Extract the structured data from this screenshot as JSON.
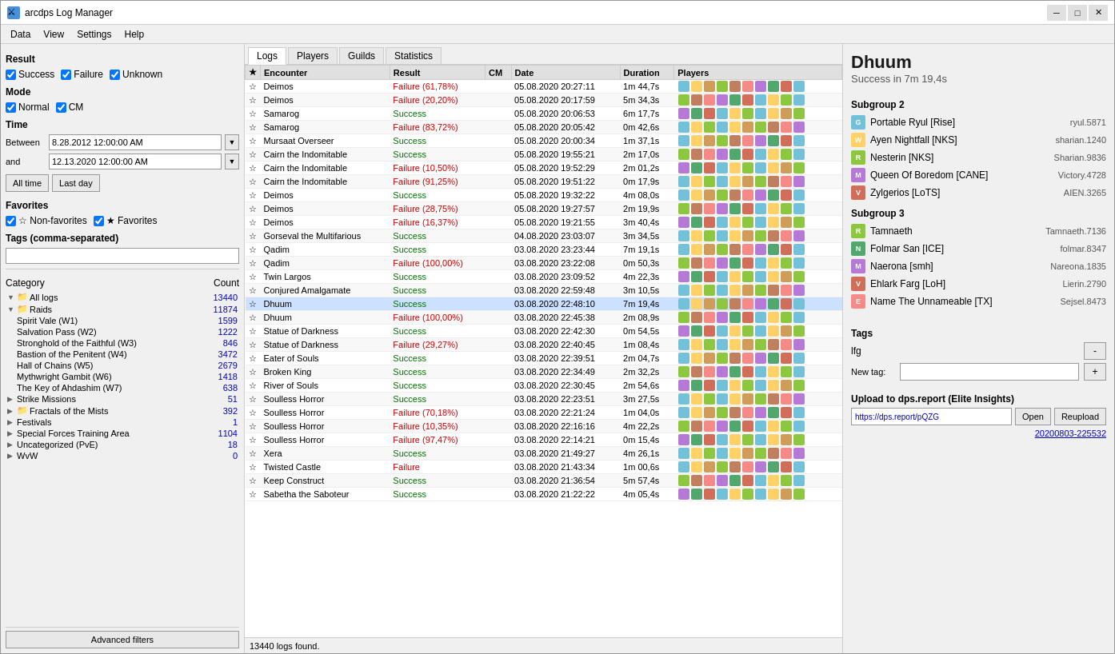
{
  "window": {
    "title": "arcdps Log Manager",
    "titlebar_icon": "⚔"
  },
  "menubar": {
    "items": [
      "Data",
      "View",
      "Settings",
      "Help"
    ]
  },
  "left_panel": {
    "result_label": "Result",
    "result_checkboxes": [
      {
        "label": "Success",
        "checked": true
      },
      {
        "label": "Failure",
        "checked": true
      },
      {
        "label": "Unknown",
        "checked": true
      }
    ],
    "mode_label": "Mode",
    "mode_checkboxes": [
      {
        "label": "Normal",
        "checked": true
      },
      {
        "label": "CM",
        "checked": true
      }
    ],
    "time_label": "Time",
    "between_label": "Between",
    "between_value": "8.28.2012 12:00:00 AM",
    "and_label": "and",
    "and_value": "12.13.2020 12:00:00 AM",
    "btn_all_time": "All time",
    "btn_last_day": "Last day",
    "favorites_label": "Favorites",
    "favorites_checkboxes": [
      {
        "label": "☆ Non-favorites",
        "checked": true
      },
      {
        "label": "★ Favorites",
        "checked": true
      }
    ],
    "tags_label": "Tags (comma-separated)",
    "tags_value": "",
    "category_label": "Category",
    "count_label": "Count",
    "categories": [
      {
        "level": 0,
        "arrow": "▼",
        "icon": "folder",
        "label": "All logs",
        "count": "13440",
        "selected": false
      },
      {
        "level": 1,
        "arrow": "▼",
        "icon": "folder-red",
        "label": "Raids",
        "count": "11874",
        "selected": false
      },
      {
        "level": 2,
        "arrow": "",
        "icon": "",
        "label": "Spirit Vale (W1)",
        "count": "1599",
        "selected": false
      },
      {
        "level": 2,
        "arrow": "",
        "icon": "",
        "label": "Salvation Pass (W2)",
        "count": "1222",
        "selected": false
      },
      {
        "level": 2,
        "arrow": "",
        "icon": "",
        "label": "Stronghold of the Faithful (W3)",
        "count": "846",
        "selected": false
      },
      {
        "level": 2,
        "arrow": "",
        "icon": "",
        "label": "Bastion of the Penitent (W4)",
        "count": "3472",
        "selected": false
      },
      {
        "level": 2,
        "arrow": "",
        "icon": "",
        "label": "Hall of Chains (W5)",
        "count": "2679",
        "selected": false
      },
      {
        "level": 2,
        "arrow": "",
        "icon": "",
        "label": "Mythwright Gambit (W6)",
        "count": "1418",
        "selected": false
      },
      {
        "level": 2,
        "arrow": "",
        "icon": "",
        "label": "The Key of Ahdashim (W7)",
        "count": "638",
        "selected": false
      },
      {
        "level": 1,
        "arrow": "▶",
        "icon": "",
        "label": "Strike Missions",
        "count": "51",
        "selected": false
      },
      {
        "level": 1,
        "arrow": "▶",
        "icon": "folder-red",
        "label": "Fractals of the Mists",
        "count": "392",
        "selected": false
      },
      {
        "level": 1,
        "arrow": "▶",
        "icon": "",
        "label": "Festivals",
        "count": "1",
        "selected": false,
        "count_color": "blue"
      },
      {
        "level": 1,
        "arrow": "▶",
        "icon": "",
        "label": "Special Forces Training Area",
        "count": "1104",
        "selected": false,
        "count_color": "blue"
      },
      {
        "level": 1,
        "arrow": "▶",
        "icon": "",
        "label": "Uncategorized (PvE)",
        "count": "18",
        "selected": false,
        "count_color": "blue"
      },
      {
        "level": 1,
        "arrow": "▶",
        "icon": "",
        "label": "WvW",
        "count": "0",
        "selected": false
      }
    ],
    "advanced_filters_label": "Advanced filters",
    "status_bar": "13440 logs found."
  },
  "tabs": {
    "items": [
      "Logs",
      "Players",
      "Guilds",
      "Statistics"
    ],
    "active": "Logs"
  },
  "log_table": {
    "columns": [
      "★",
      "Encounter",
      "Result",
      "CM",
      "Date",
      "Duration",
      "Players"
    ],
    "rows": [
      {
        "star": "☆",
        "encounter": "Deimos",
        "result": "Failure (61,78%)",
        "result_type": "failure",
        "cm": "",
        "date": "05.08.2020 20:27:11",
        "duration": "1m 44,7s",
        "selected": false
      },
      {
        "star": "☆",
        "encounter": "Deimos",
        "result": "Failure (20,20%)",
        "result_type": "failure",
        "cm": "",
        "date": "05.08.2020 20:17:59",
        "duration": "5m 34,3s",
        "selected": false
      },
      {
        "star": "☆",
        "encounter": "Samarog",
        "result": "Success",
        "result_type": "success",
        "cm": "",
        "date": "05.08.2020 20:06:53",
        "duration": "6m 17,7s",
        "selected": false
      },
      {
        "star": "☆",
        "encounter": "Samarog",
        "result": "Failure (83,72%)",
        "result_type": "failure",
        "cm": "",
        "date": "05.08.2020 20:05:42",
        "duration": "0m 42,6s",
        "selected": false
      },
      {
        "star": "☆",
        "encounter": "Mursaat Overseer",
        "result": "Success",
        "result_type": "success",
        "cm": "",
        "date": "05.08.2020 20:00:34",
        "duration": "1m 37,1s",
        "selected": false
      },
      {
        "star": "☆",
        "encounter": "Cairn the Indomitable",
        "result": "Success",
        "result_type": "success",
        "cm": "",
        "date": "05.08.2020 19:55:21",
        "duration": "2m 17,0s",
        "selected": false
      },
      {
        "star": "☆",
        "encounter": "Cairn the Indomitable",
        "result": "Failure (10,50%)",
        "result_type": "failure",
        "cm": "",
        "date": "05.08.2020 19:52:29",
        "duration": "2m 01,2s",
        "selected": false
      },
      {
        "star": "☆",
        "encounter": "Cairn the Indomitable",
        "result": "Failure (91,25%)",
        "result_type": "failure",
        "cm": "",
        "date": "05.08.2020 19:51:22",
        "duration": "0m 17,9s",
        "selected": false
      },
      {
        "star": "☆",
        "encounter": "Deimos",
        "result": "Success",
        "result_type": "success",
        "cm": "",
        "date": "05.08.2020 19:32:22",
        "duration": "4m 08,0s",
        "selected": false
      },
      {
        "star": "☆",
        "encounter": "Deimos",
        "result": "Failure (28,75%)",
        "result_type": "failure",
        "cm": "",
        "date": "05.08.2020 19:27:57",
        "duration": "2m 19,9s",
        "selected": false
      },
      {
        "star": "☆",
        "encounter": "Deimos",
        "result": "Failure (16,37%)",
        "result_type": "failure",
        "cm": "",
        "date": "05.08.2020 19:21:55",
        "duration": "3m 40,4s",
        "selected": false
      },
      {
        "star": "☆",
        "encounter": "Gorseval the Multifarious",
        "result": "Success",
        "result_type": "success",
        "cm": "",
        "date": "04.08.2020 23:03:07",
        "duration": "3m 34,5s",
        "selected": false
      },
      {
        "star": "☆",
        "encounter": "Qadim",
        "result": "Success",
        "result_type": "success",
        "cm": "",
        "date": "03.08.2020 23:23:44",
        "duration": "7m 19,1s",
        "selected": false
      },
      {
        "star": "☆",
        "encounter": "Qadim",
        "result": "Failure (100,00%)",
        "result_type": "failure",
        "cm": "",
        "date": "03.08.2020 23:22:08",
        "duration": "0m 50,3s",
        "selected": false
      },
      {
        "star": "☆",
        "encounter": "Twin Largos",
        "result": "Success",
        "result_type": "success",
        "cm": "",
        "date": "03.08.2020 23:09:52",
        "duration": "4m 22,3s",
        "selected": false
      },
      {
        "star": "☆",
        "encounter": "Conjured Amalgamate",
        "result": "Success",
        "result_type": "success",
        "cm": "",
        "date": "03.08.2020 22:59:48",
        "duration": "3m 10,5s",
        "selected": false
      },
      {
        "star": "☆",
        "encounter": "Dhuum",
        "result": "Success",
        "result_type": "success",
        "cm": "",
        "date": "03.08.2020 22:48:10",
        "duration": "7m 19,4s",
        "selected": true
      },
      {
        "star": "☆",
        "encounter": "Dhuum",
        "result": "Failure (100,00%)",
        "result_type": "failure",
        "cm": "",
        "date": "03.08.2020 22:45:38",
        "duration": "2m 08,9s",
        "selected": false
      },
      {
        "star": "☆",
        "encounter": "Statue of Darkness",
        "result": "Success",
        "result_type": "success",
        "cm": "",
        "date": "03.08.2020 22:42:30",
        "duration": "0m 54,5s",
        "selected": false
      },
      {
        "star": "☆",
        "encounter": "Statue of Darkness",
        "result": "Failure (29,27%)",
        "result_type": "failure",
        "cm": "",
        "date": "03.08.2020 22:40:45",
        "duration": "1m 08,4s",
        "selected": false
      },
      {
        "star": "☆",
        "encounter": "Eater of Souls",
        "result": "Success",
        "result_type": "success",
        "cm": "",
        "date": "03.08.2020 22:39:51",
        "duration": "2m 04,7s",
        "selected": false
      },
      {
        "star": "☆",
        "encounter": "Broken King",
        "result": "Success",
        "result_type": "success",
        "cm": "",
        "date": "03.08.2020 22:34:49",
        "duration": "2m 32,2s",
        "selected": false
      },
      {
        "star": "☆",
        "encounter": "River of Souls",
        "result": "Success",
        "result_type": "success",
        "cm": "",
        "date": "03.08.2020 22:30:45",
        "duration": "2m 54,6s",
        "selected": false
      },
      {
        "star": "☆",
        "encounter": "Soulless Horror",
        "result": "Success",
        "result_type": "success",
        "cm": "",
        "date": "03.08.2020 22:23:51",
        "duration": "3m 27,5s",
        "selected": false
      },
      {
        "star": "☆",
        "encounter": "Soulless Horror",
        "result": "Failure (70,18%)",
        "result_type": "failure",
        "cm": "",
        "date": "03.08.2020 22:21:24",
        "duration": "1m 04,0s",
        "selected": false
      },
      {
        "star": "☆",
        "encounter": "Soulless Horror",
        "result": "Failure (10,35%)",
        "result_type": "failure",
        "cm": "",
        "date": "03.08.2020 22:16:16",
        "duration": "4m 22,2s",
        "selected": false
      },
      {
        "star": "☆",
        "encounter": "Soulless Horror",
        "result": "Failure (97,47%)",
        "result_type": "failure",
        "cm": "",
        "date": "03.08.2020 22:14:21",
        "duration": "0m 15,4s",
        "selected": false
      },
      {
        "star": "☆",
        "encounter": "Xera",
        "result": "Success",
        "result_type": "success",
        "cm": "",
        "date": "03.08.2020 21:49:27",
        "duration": "4m 26,1s",
        "selected": false
      },
      {
        "star": "☆",
        "encounter": "Twisted Castle",
        "result": "Failure",
        "result_type": "failure",
        "cm": "",
        "date": "03.08.2020 21:43:34",
        "duration": "1m 00,6s",
        "selected": false
      },
      {
        "star": "☆",
        "encounter": "Keep Construct",
        "result": "Success",
        "result_type": "success",
        "cm": "",
        "date": "03.08.2020 21:36:54",
        "duration": "5m 57,4s",
        "selected": false
      },
      {
        "star": "☆",
        "encounter": "Sabetha the Saboteur",
        "result": "Success",
        "result_type": "success",
        "cm": "",
        "date": "03.08.2020 21:22:22",
        "duration": "4m 05,4s",
        "selected": false
      }
    ]
  },
  "right_panel": {
    "boss_name": "Dhuum",
    "boss_result": "Success in 7m 19,4s",
    "subgroups": [
      {
        "label": "Subgroup 2",
        "players": [
          {
            "prof_color": "#72c1d9",
            "prof_letter": "G",
            "name": "Portable Ryul [Rise]",
            "account": "ryul.5871"
          },
          {
            "prof_color": "#ffd166",
            "prof_letter": "W",
            "name": "Ayen Nightfall [NKS]",
            "account": "sharian.1240"
          },
          {
            "prof_color": "#8dc63f",
            "prof_letter": "R",
            "name": "Nesterin [NKS]",
            "account": "Sharian.9836"
          },
          {
            "prof_color": "#b679d5",
            "prof_letter": "M",
            "name": "Queen Of Boredom [CANE]",
            "account": "Victory.4728"
          },
          {
            "prof_color": "#d16e5a",
            "prof_letter": "V",
            "name": "Zylgerios [LoTS]",
            "account": "AIEN.3265"
          }
        ]
      },
      {
        "label": "Subgroup 3",
        "players": [
          {
            "prof_color": "#8dc63f",
            "prof_letter": "R",
            "name": "Tamnaeth",
            "account": "Tamnaeth.7136"
          },
          {
            "prof_color": "#52a76f",
            "prof_letter": "N",
            "name": "Folmar San [ICE]",
            "account": "folmar.8347"
          },
          {
            "prof_color": "#b679d5",
            "prof_letter": "M",
            "name": "Naerona [smh]",
            "account": "Nareona.1835"
          },
          {
            "prof_color": "#d16e5a",
            "prof_letter": "V",
            "name": "Ehlark Farg [LoH]",
            "account": "Lierin.2790"
          },
          {
            "prof_color": "#f68a87",
            "prof_letter": "E",
            "name": "Name The Unnameable [TX]",
            "account": "Sejsel.8473"
          }
        ]
      }
    ],
    "tags_label": "Tags",
    "tag_value": "lfg",
    "tag_btn_label": "-",
    "new_tag_label": "New tag:",
    "new_tag_placeholder": "",
    "new_tag_btn": "+",
    "upload_label": "Upload to dps.report (Elite Insights)",
    "url_value": "https://dps.report/pQZG",
    "open_btn": "Open",
    "reupload_btn": "Reupload",
    "log_id": "20200803-225532"
  }
}
